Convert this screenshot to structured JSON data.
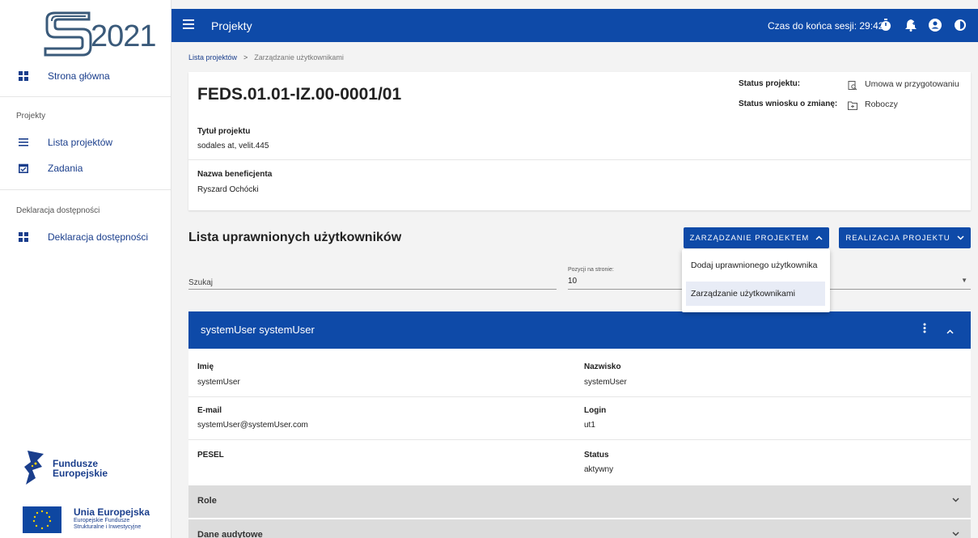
{
  "sidebar": {
    "logo_year": "2021",
    "items": [
      {
        "label": "Strona główna",
        "icon": "dashboard-icon"
      },
      {
        "label": "Lista projektów",
        "icon": "list-icon"
      },
      {
        "label": "Zadania",
        "icon": "task-icon"
      },
      {
        "label": "Deklaracja dostępności",
        "icon": "dashboard-icon"
      }
    ],
    "sections": [
      "Projekty",
      "Deklaracja dostępności"
    ],
    "funds_logo": {
      "line1": "Fundusze",
      "line2": "Europejskie"
    },
    "eu_logo": {
      "line1": "Unia Europejska",
      "line2": "Europejskie Fundusze",
      "line3": "Strukturalne i Inwestycyjne"
    }
  },
  "topbar": {
    "title": "Projekty",
    "session_label": "Czas do końca sesji: 29:42",
    "icons": [
      "timer-icon",
      "notifications-icon",
      "account-icon",
      "contrast-icon"
    ],
    "bg_color": "#0e4aa8"
  },
  "breadcrumb": {
    "link": "Lista projektów",
    "separator": ">",
    "current": "Zarządzanie użytkownikami"
  },
  "project": {
    "id": "FEDS.01.01-IZ.00-0001/01",
    "status_label": "Status projektu:",
    "status_value": "Umowa w przygotowaniu",
    "change_label": "Status wniosku o zmianę:",
    "change_value": "Roboczy",
    "title_label": "Tytuł projektu",
    "title_value": "sodales at, velit.445",
    "beneficiary_label": "Nazwa beneficjenta",
    "beneficiary_value": "Ryszard Ochócki"
  },
  "list": {
    "title": "Lista uprawnionych użytkowników",
    "btn_manage": "ZARZĄDZANIE PROJEKTEM",
    "btn_realization": "REALIZACJA PROJEKTU",
    "search_placeholder": "Szukaj",
    "per_page_label": "Pozycji na stronie:",
    "per_page_value": "10"
  },
  "dropdown": {
    "items": [
      "Dodaj uprawnionego użytkownika",
      "Zarządzanie użytkownikami"
    ]
  },
  "user": {
    "header": "systemUser systemUser",
    "fields": {
      "first_name_label": "Imię",
      "first_name": "systemUser",
      "last_name_label": "Nazwisko",
      "last_name": "systemUser",
      "email_label": "E-mail",
      "email": "systemUser@systemUser.com",
      "login_label": "Login",
      "login": "ut1",
      "pesel_label": "PESEL",
      "pesel": "",
      "status_label": "Status",
      "status": "aktywny"
    },
    "sections": [
      "Role",
      "Dane audytowe"
    ]
  }
}
